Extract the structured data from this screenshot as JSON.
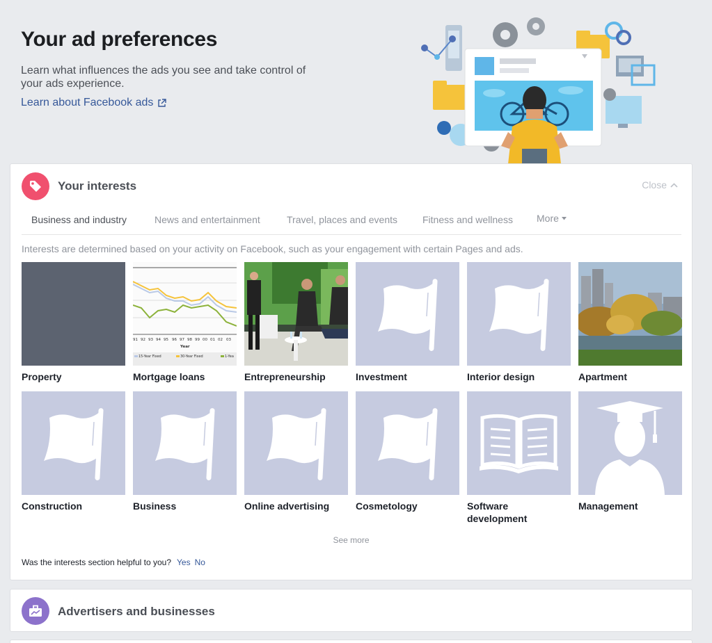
{
  "header": {
    "title": "Your ad preferences",
    "description": "Learn what influences the ads you see and take control of your ads experience.",
    "learn_link": "Learn about Facebook ads"
  },
  "interests": {
    "title": "Your interests",
    "close_label": "Close",
    "tabs": [
      {
        "label": "Business and industry",
        "active": true
      },
      {
        "label": "News and entertainment",
        "active": false
      },
      {
        "label": "Travel, places and events",
        "active": false
      },
      {
        "label": "Fitness and wellness",
        "active": false
      }
    ],
    "more_label": "More",
    "info_text": "Interests are determined based on your activity on Facebook, such as your engagement with certain Pages and ads.",
    "items": [
      {
        "label": "Property",
        "image": "dark-placeholder"
      },
      {
        "label": "Mortgage loans",
        "image": "rate-chart"
      },
      {
        "label": "Entrepreneurship",
        "image": "panel-photo"
      },
      {
        "label": "Investment",
        "image": "flag-icon"
      },
      {
        "label": "Interior design",
        "image": "flag-icon"
      },
      {
        "label": "Apartment",
        "image": "city-park-photo"
      },
      {
        "label": "Construction",
        "image": "flag-icon"
      },
      {
        "label": "Business",
        "image": "flag-icon"
      },
      {
        "label": "Online advertising",
        "image": "flag-icon"
      },
      {
        "label": "Cosmetology",
        "image": "flag-icon"
      },
      {
        "label": "Software development",
        "image": "book-icon"
      },
      {
        "label": "Management",
        "image": "graduate-icon"
      }
    ],
    "mortgage_chart": {
      "x_ticks": [
        "91",
        "92",
        "93",
        "94",
        "95",
        "96",
        "97",
        "98",
        "99",
        "00",
        "01",
        "02",
        "03"
      ],
      "x_label": "Year",
      "legend": [
        "15-Year Fixed",
        "30-Year Fixed",
        "1-Yea"
      ]
    },
    "see_more": "See more",
    "helpful_question": "Was the interests section helpful to you?",
    "helpful_yes": "Yes",
    "helpful_no": "No"
  },
  "advertisers": {
    "title": "Advertisers and businesses"
  },
  "colors": {
    "link": "#365899",
    "interests_icon": "#f0506e",
    "advertisers_icon": "#8c72cb",
    "placeholder": "#c6cbe0"
  }
}
